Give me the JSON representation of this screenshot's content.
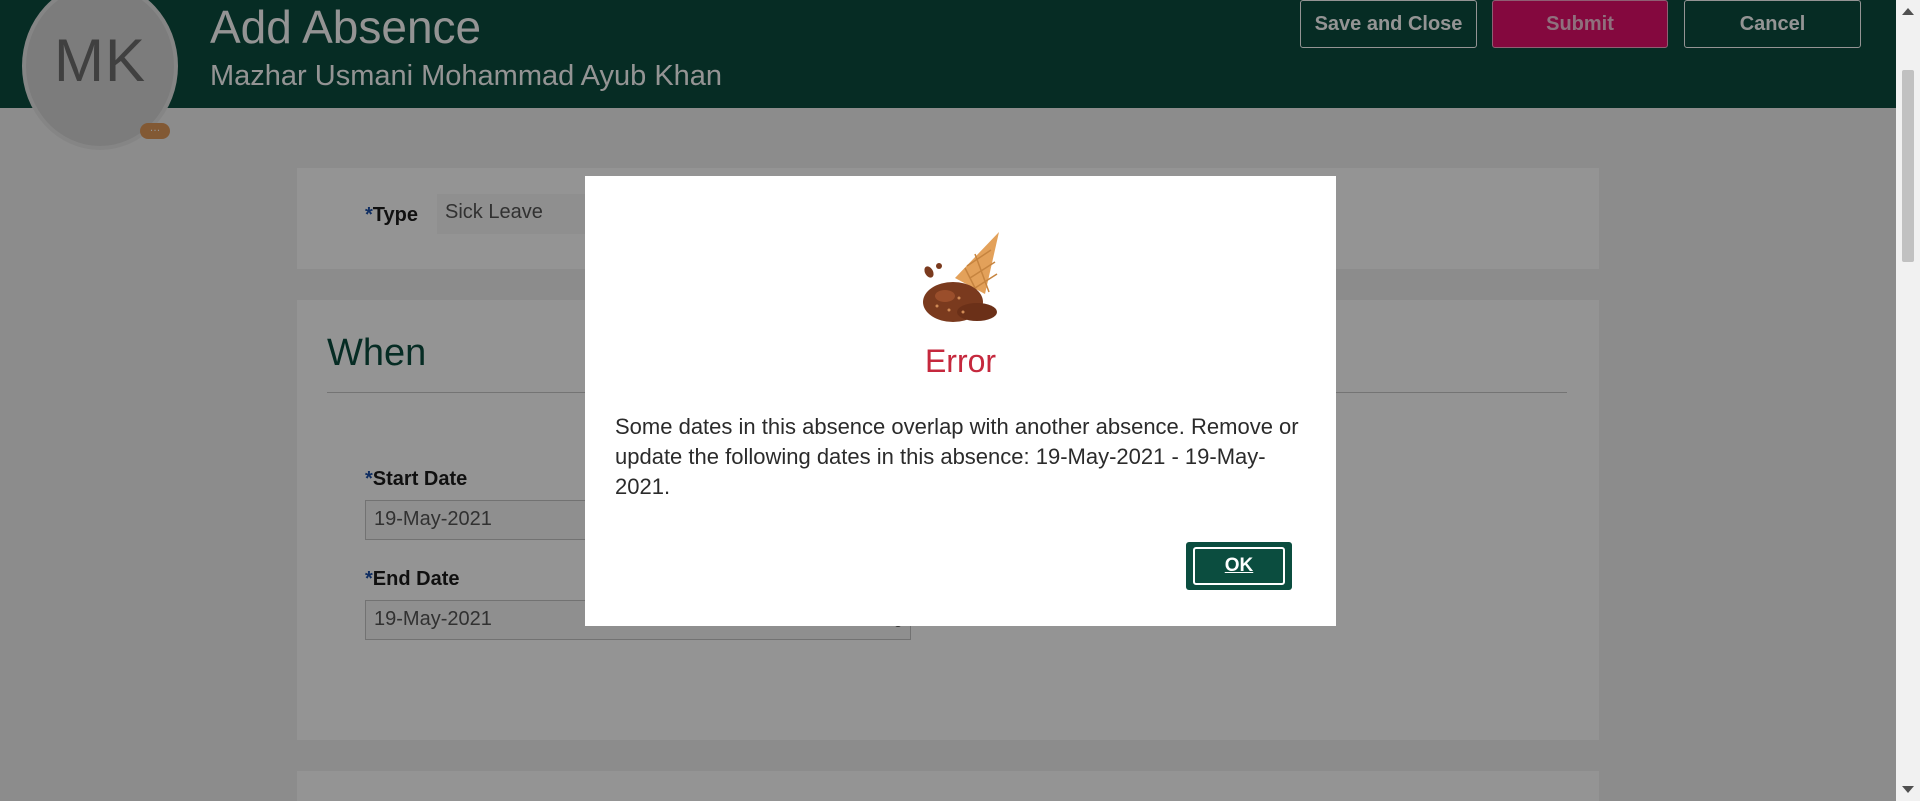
{
  "header": {
    "avatar_initials": "MK",
    "avatar_badge": "…",
    "title": "Add Absence",
    "person_name": "Mazhar Usmani Mohammad Ayub Khan",
    "buttons": {
      "save_close": "Save and Close",
      "submit": "Submit",
      "cancel": "Cancel"
    }
  },
  "form": {
    "type_label": "Type",
    "type_value": "Sick Leave",
    "section_when": "When",
    "start_date_label": "Start Date",
    "start_date_value": "19-May-2021",
    "end_date_label": "End Date",
    "end_date_value": "19-May-2021",
    "required_mark": "*"
  },
  "dialog": {
    "title": "Error",
    "message": "Some dates in this absence overlap with another absence. Remove or update the following dates in this absence: 19-May-2021 - 19-May-2021.",
    "ok_label": "OK",
    "icon": "dropped-ice-cream-icon"
  },
  "colors": {
    "header_bg": "#0b4d3f",
    "submit_bg": "#e40f6b",
    "error_title": "#c5283d"
  }
}
